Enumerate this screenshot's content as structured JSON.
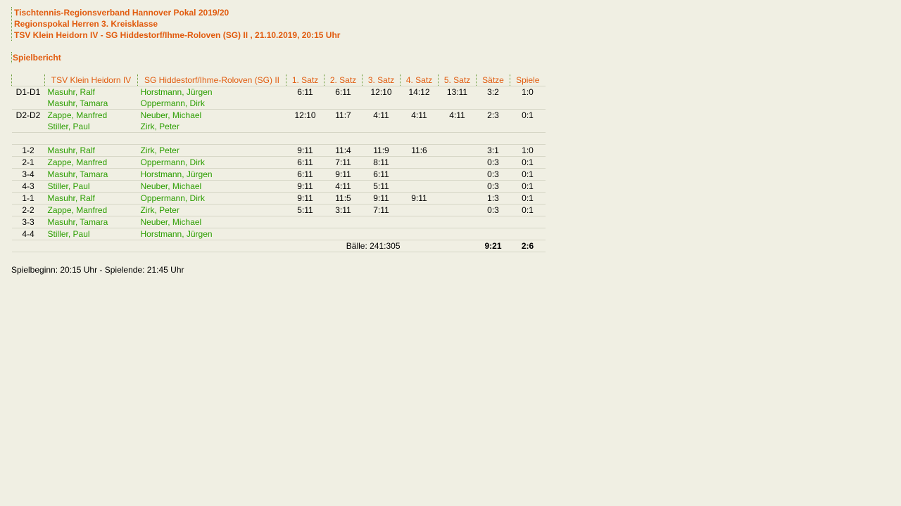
{
  "header": {
    "line1": "Tischtennis-Regionsverband Hannover Pokal 2019/20",
    "line2": "Regionspokal Herren 3. Kreisklasse",
    "line3": "TSV Klein Heidorn IV - SG Hiddestorf/Ihme-Roloven (SG) II , 21.10.2019, 20:15 Uhr"
  },
  "section_title": "Spielbericht",
  "table": {
    "columns": [
      "",
      "TSV Klein Heidorn IV",
      "SG Hiddestorf/Ihme-Roloven (SG) II",
      "1. Satz",
      "2. Satz",
      "3. Satz",
      "4. Satz",
      "5. Satz",
      "Sätze",
      "Spiele"
    ],
    "doubles": [
      {
        "pos": "D1-D1",
        "home": [
          "Masuhr, Ralf",
          "Masuhr, Tamara"
        ],
        "away": [
          "Horstmann, Jürgen",
          "Oppermann, Dirk"
        ],
        "sets": [
          "6:11",
          "6:11",
          "12:10",
          "14:12",
          "13:11"
        ],
        "saetze": "3:2",
        "spiele": "1:0"
      },
      {
        "pos": "D2-D2",
        "home": [
          "Zappe, Manfred",
          "Stiller, Paul"
        ],
        "away": [
          "Neuber, Michael",
          "Zirk, Peter"
        ],
        "sets": [
          "12:10",
          "11:7",
          "4:11",
          "4:11",
          "4:11"
        ],
        "saetze": "2:3",
        "spiele": "0:1"
      }
    ],
    "singles": [
      {
        "pos": "1-2",
        "home": "Masuhr, Ralf",
        "away": "Zirk, Peter",
        "sets": [
          "9:11",
          "11:4",
          "11:9",
          "11:6",
          ""
        ],
        "saetze": "3:1",
        "spiele": "1:0"
      },
      {
        "pos": "2-1",
        "home": "Zappe, Manfred",
        "away": "Oppermann, Dirk",
        "sets": [
          "6:11",
          "7:11",
          "8:11",
          "",
          ""
        ],
        "saetze": "0:3",
        "spiele": "0:1"
      },
      {
        "pos": "3-4",
        "home": "Masuhr, Tamara",
        "away": "Horstmann, Jürgen",
        "sets": [
          "6:11",
          "9:11",
          "6:11",
          "",
          ""
        ],
        "saetze": "0:3",
        "spiele": "0:1"
      },
      {
        "pos": "4-3",
        "home": "Stiller, Paul",
        "away": "Neuber, Michael",
        "sets": [
          "9:11",
          "4:11",
          "5:11",
          "",
          ""
        ],
        "saetze": "0:3",
        "spiele": "0:1"
      },
      {
        "pos": "1-1",
        "home": "Masuhr, Ralf",
        "away": "Oppermann, Dirk",
        "sets": [
          "9:11",
          "11:5",
          "9:11",
          "9:11",
          ""
        ],
        "saetze": "1:3",
        "spiele": "0:1"
      },
      {
        "pos": "2-2",
        "home": "Zappe, Manfred",
        "away": "Zirk, Peter",
        "sets": [
          "5:11",
          "3:11",
          "7:11",
          "",
          ""
        ],
        "saetze": "0:3",
        "spiele": "0:1"
      },
      {
        "pos": "3-3",
        "home": "Masuhr, Tamara",
        "away": "Neuber, Michael",
        "sets": [
          "",
          "",
          "",
          "",
          ""
        ],
        "saetze": "",
        "spiele": ""
      },
      {
        "pos": "4-4",
        "home": "Stiller, Paul",
        "away": "Horstmann, Jürgen",
        "sets": [
          "",
          "",
          "",
          "",
          ""
        ],
        "saetze": "",
        "spiele": ""
      }
    ],
    "totals": {
      "balls": "Bälle: 241:305",
      "saetze": "9:21",
      "spiele": "2:6"
    }
  },
  "footer": "Spielbeginn: 20:15 Uhr - Spielende: 21:45 Uhr",
  "colors": {
    "heading": "#e15b0e",
    "player": "#2b9e00",
    "background": "#f0efe3"
  }
}
